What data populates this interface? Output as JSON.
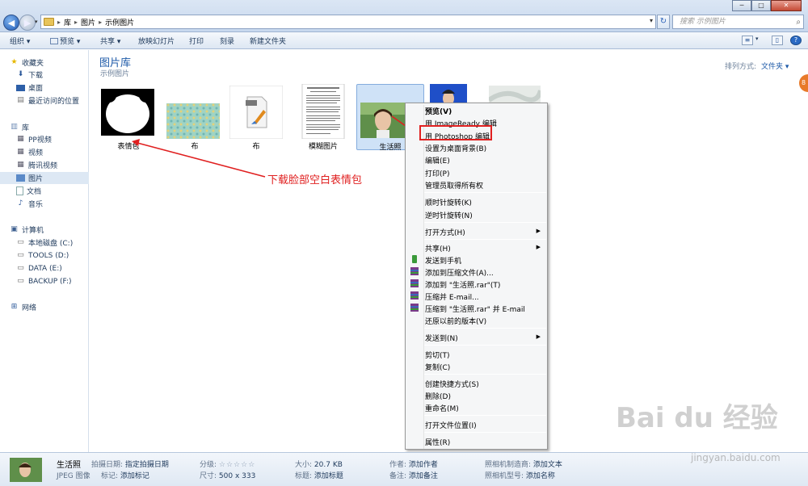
{
  "address_bar": {
    "crumbs": [
      "库",
      "图片",
      "示例图片"
    ],
    "search_placeholder": "搜索 示例图片"
  },
  "toolbar": {
    "organize": "组织 ▾",
    "preview": "预览 ▾",
    "share": "共享 ▾",
    "slideshow": "放映幻灯片",
    "print": "打印",
    "burn": "刻录",
    "new_folder": "新建文件夹"
  },
  "sidebar": {
    "items": [
      {
        "label": "收藏夹",
        "icon": "star-icon"
      },
      {
        "label": "下载",
        "icon": "download-folder-icon"
      },
      {
        "label": "桌面",
        "icon": "desktop-icon"
      },
      {
        "label": "最近访问的位置",
        "icon": "recent-places-icon"
      },
      {
        "label": "库",
        "icon": "library-icon"
      },
      {
        "label": "PP视频",
        "icon": "video-library-icon"
      },
      {
        "label": "视频",
        "icon": "video-library-icon"
      },
      {
        "label": "腾讯视频",
        "icon": "video-library-icon"
      },
      {
        "label": "图片",
        "icon": "pictures-library-icon"
      },
      {
        "label": "文档",
        "icon": "documents-library-icon"
      },
      {
        "label": "音乐",
        "icon": "music-library-icon"
      },
      {
        "label": "计算机",
        "icon": "computer-icon"
      },
      {
        "label": "本地磁盘 (C:)",
        "icon": "drive-icon"
      },
      {
        "label": "TOOLS (D:)",
        "icon": "drive-icon"
      },
      {
        "label": "DATA (E:)",
        "icon": "drive-icon"
      },
      {
        "label": "BACKUP (F:)",
        "icon": "drive-icon"
      },
      {
        "label": "网络",
        "icon": "network-icon"
      }
    ]
  },
  "main": {
    "title": "图片库",
    "subtitle": "示例图片",
    "sort_label": "排列方式:",
    "sort_value": "文件夹 ▾",
    "files": [
      "表情包",
      "布",
      "布",
      "模糊图片",
      "生活照"
    ]
  },
  "context_menu": {
    "items": [
      {
        "label": "预览(V)",
        "bold": true
      },
      {
        "label": "用 ImageReady 编辑"
      },
      {
        "label": "用 Photoshop 编辑"
      },
      {
        "label": "设置为桌面背景(B)"
      },
      {
        "label": "编辑(E)"
      },
      {
        "label": "打印(P)"
      },
      {
        "label": "管理员取得所有权"
      },
      {
        "label": "顺时针旋转(K)"
      },
      {
        "label": "逆时针旋转(N)"
      },
      {
        "label": "打开方式(H)",
        "submenu": true
      },
      {
        "label": "共享(H)",
        "submenu": true
      },
      {
        "label": "发送到手机"
      },
      {
        "label": "添加到压缩文件(A)..."
      },
      {
        "label": "添加到 \"生活照.rar\"(T)"
      },
      {
        "label": "压缩并 E-mail..."
      },
      {
        "label": "压缩到 \"生活照.rar\" 并 E-mail"
      },
      {
        "label": "还原以前的版本(V)"
      },
      {
        "label": "发送到(N)",
        "submenu": true
      },
      {
        "label": "剪切(T)"
      },
      {
        "label": "复制(C)"
      },
      {
        "label": "创建快捷方式(S)"
      },
      {
        "label": "删除(D)"
      },
      {
        "label": "重命名(M)"
      },
      {
        "label": "打开文件位置(I)"
      },
      {
        "label": "属性(R)"
      }
    ]
  },
  "annotation": "下载脸部空白表情包",
  "details": {
    "name": "生活照",
    "type": "JPEG 图像",
    "date_label": "拍摄日期:",
    "date_value": "指定拍摄日期",
    "tags_label": "标记:",
    "tags_value": "添加标记",
    "rating_label": "分级:",
    "rating_stars": "☆☆☆☆☆",
    "dims_label": "尺寸:",
    "dims_value": "500 x 333",
    "size_label": "大小:",
    "size_value": "20.7 KB",
    "title_label": "标题:",
    "title_value": "添加标题",
    "author_label": "作者:",
    "author_value": "添加作者",
    "comment_label": "备注:",
    "comment_value": "添加备注",
    "maker_label": "照相机制造商:",
    "maker_value": "添加文本",
    "model_label": "照相机型号:",
    "model_value": "添加名称"
  },
  "watermark": {
    "text": "Bai du 经验",
    "url": "jingyan.baidu.com"
  },
  "colors": {
    "annotation_red": "#e02020",
    "link_blue": "#1e5aa8"
  }
}
